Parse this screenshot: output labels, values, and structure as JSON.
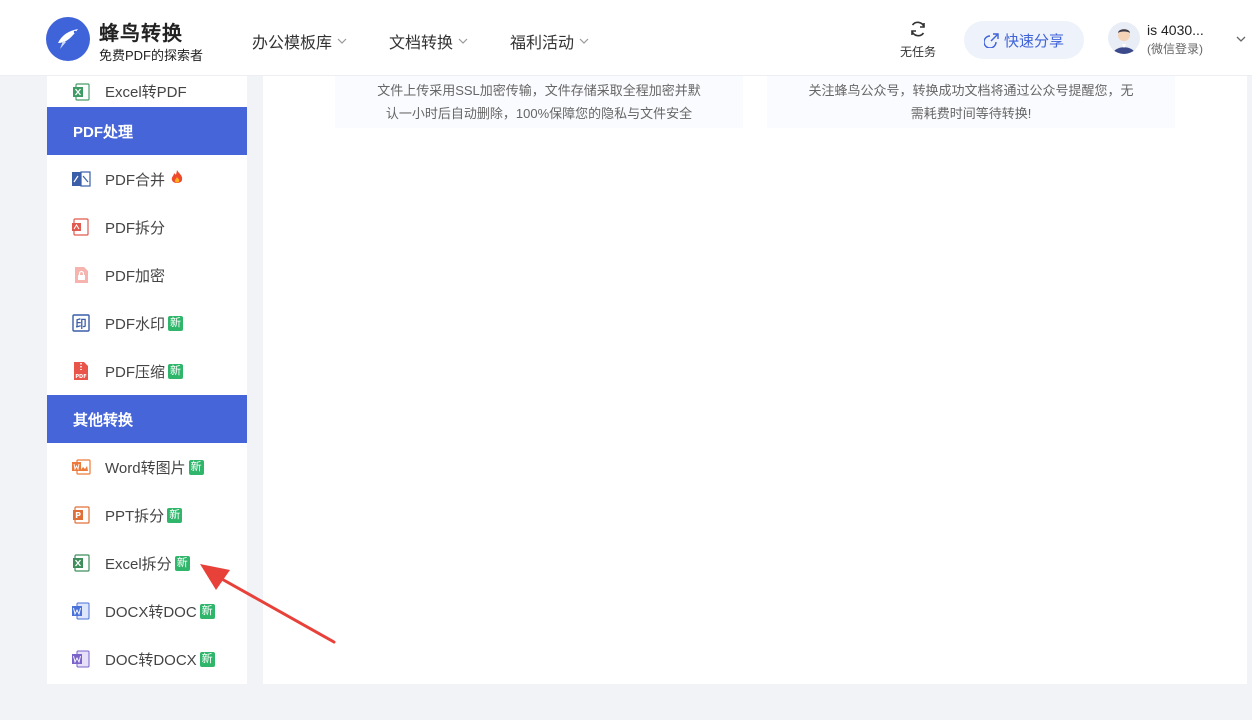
{
  "header": {
    "brand_name": "蜂鸟转换",
    "brand_sub": "免费PDF的探索者",
    "nav": [
      "办公模板库",
      "文档转换",
      "福利活动"
    ],
    "task_label": "无任务",
    "share_label": "快速分享",
    "user_name": "is 4030...",
    "user_login": "(微信登录)"
  },
  "sidebar": {
    "top_item": "Excel转PDF",
    "sections": [
      {
        "title": "PDF处理",
        "items": [
          {
            "label": "PDF合并",
            "badge": "",
            "hot": true,
            "icon": "pdf-merge-icon"
          },
          {
            "label": "PDF拆分",
            "badge": "",
            "hot": false,
            "icon": "pdf-split-icon"
          },
          {
            "label": "PDF加密",
            "badge": "",
            "hot": false,
            "icon": "pdf-lock-icon"
          },
          {
            "label": "PDF水印",
            "badge": "新",
            "hot": false,
            "icon": "pdf-watermark-icon"
          },
          {
            "label": "PDF压缩",
            "badge": "新",
            "hot": false,
            "icon": "pdf-compress-icon"
          }
        ]
      },
      {
        "title": "其他转换",
        "items": [
          {
            "label": "Word转图片",
            "badge": "新",
            "icon": "word-image-icon"
          },
          {
            "label": "PPT拆分",
            "badge": "新",
            "icon": "ppt-split-icon"
          },
          {
            "label": "Excel拆分",
            "badge": "新",
            "icon": "excel-split-icon"
          },
          {
            "label": "DOCX转DOC",
            "badge": "新",
            "icon": "word-icon"
          },
          {
            "label": "DOC转DOCX",
            "badge": "新",
            "icon": "word-purple-icon"
          }
        ]
      }
    ]
  },
  "main": {
    "security_text_1": "文件上传采用SSL加密传输，文件存储采取全程加密并默",
    "security_text_2": "认一小时后自动删除，100%保障您的隐私与文件安全",
    "notify_text_1": "关注蜂鸟公众号，转换成功文档将通过公众号提醒您，无",
    "notify_text_2": "需耗费时间等待转换!"
  },
  "colors": {
    "accent": "#4665d8",
    "new_badge": "#2fb66b",
    "arrow": "#e8413a"
  }
}
